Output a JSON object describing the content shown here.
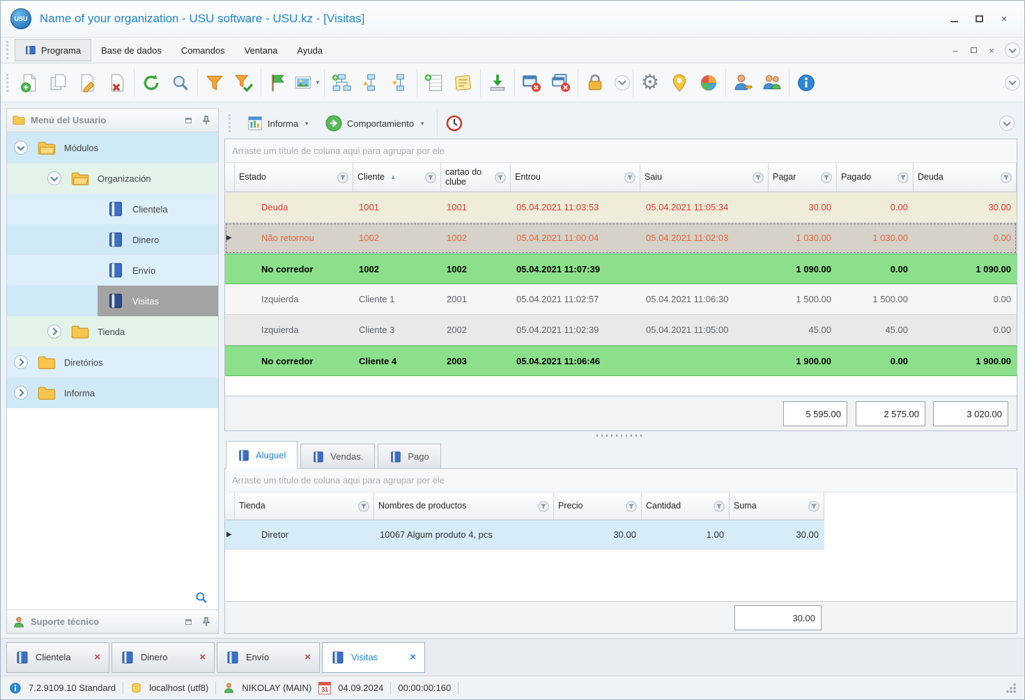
{
  "window": {
    "logo_text": "USU",
    "title": "Name of your organization - USU software - USU.kz - [Visitas]"
  },
  "menubar": {
    "items": [
      "Programa",
      "Base de dados",
      "Comandos",
      "Ventana",
      "Ayuda"
    ]
  },
  "report_toolbar": {
    "informa": "Informa",
    "comportamiento": "Comportamiento"
  },
  "sidebar": {
    "title": "Menú del Usuario",
    "items": [
      {
        "label": "Módulos"
      },
      {
        "label": "Organización"
      },
      {
        "label": "Clientela"
      },
      {
        "label": "Dinero"
      },
      {
        "label": "Envío"
      },
      {
        "label": "Visitas"
      },
      {
        "label": "Tienda"
      },
      {
        "label": "Diretórios"
      },
      {
        "label": "Informa"
      }
    ],
    "support_title": "Suporte técnico"
  },
  "main_grid": {
    "group_hint": "Arraste um título de coluna aqui para agrupar por ele",
    "columns": [
      "Estado",
      "Cliente",
      "cartao do clube",
      "Entrou",
      "Saiu",
      "Pagar",
      "Pagado",
      "Deuda"
    ],
    "rows": [
      {
        "estado": "Deuda",
        "cliente": "1001",
        "cartao": "1001",
        "entrou": "05.04.2021 11:03:53",
        "saiu": "05.04.2021 11:05:34",
        "pagar": "30.00",
        "pagado": "0.00",
        "deuda": "30.00"
      },
      {
        "estado": "Não retornou",
        "cliente": "1002",
        "cartao": "1002",
        "entrou": "05.04.2021 11:00:04",
        "saiu": "05.04.2021 11:02:03",
        "pagar": "1 030.00",
        "pagado": "1 030.00",
        "deuda": "0.00"
      },
      {
        "estado": "No corredor",
        "cliente": "1002",
        "cartao": "1002",
        "entrou": "05.04.2021 11:07:39",
        "saiu": "",
        "pagar": "1 090.00",
        "pagado": "0.00",
        "deuda": "1 090.00"
      },
      {
        "estado": "Izquierda",
        "cliente": "Cliente 1",
        "cartao": "2001",
        "entrou": "05.04.2021 11:02:57",
        "saiu": "05.04.2021 11:06:30",
        "pagar": "1 500.00",
        "pagado": "1 500.00",
        "deuda": "0.00"
      },
      {
        "estado": "Izquierda",
        "cliente": "Cliente 3",
        "cartao": "2002",
        "entrou": "05.04.2021 11:02:39",
        "saiu": "05.04.2021 11:05:00",
        "pagar": "45.00",
        "pagado": "45.00",
        "deuda": "0.00"
      },
      {
        "estado": "No corredor",
        "cliente": "Cliente 4",
        "cartao": "2003",
        "entrou": "05.04.2021 11:06:46",
        "saiu": "",
        "pagar": "1 900.00",
        "pagado": "0.00",
        "deuda": "1 900.00"
      }
    ],
    "totals": [
      "5 595.00",
      "2 575.00",
      "3 020.00"
    ]
  },
  "detail_tabs": [
    {
      "label": "Aluguel"
    },
    {
      "label": "Vendas."
    },
    {
      "label": "Pago"
    }
  ],
  "detail_grid": {
    "group_hint": "Arraste um título de coluna aqui para agrupar por ele",
    "columns": [
      "Tienda",
      "Nombres de productos",
      "Precio",
      "Cantidad",
      "Suma"
    ],
    "rows": [
      {
        "tienda": "Diretor",
        "produto": "10067 Algum produto 4, pcs",
        "precio": "30.00",
        "cantidad": "1.00",
        "suma": "30.00"
      }
    ],
    "total": "30.00"
  },
  "window_tabs": [
    {
      "label": "Clientela"
    },
    {
      "label": "Dinero"
    },
    {
      "label": "Envío"
    },
    {
      "label": "Visitas"
    }
  ],
  "statusbar": {
    "version": "7.2.9109.10 Standard",
    "database": "localhost (utf8)",
    "user": "NIKOLAY (MAIN)",
    "calendar_day": "31",
    "date": "04.09.2024",
    "timer": "00:00:00:160"
  },
  "icons": {
    "close_x": "×",
    "minimize": "–",
    "caret_down": "▼",
    "sort_asc": "▲",
    "row_marker": "▶",
    "gear": "⚙"
  },
  "colors": {
    "accent_blue": "#1f85d6",
    "row_green": "#8ce08b",
    "row_debt_bg": "#efecd9",
    "row_debt_text": "#e03a2f",
    "row_noreturn_bg": "#d6d2c9",
    "row_noreturn_text": "#e0653a",
    "selected_tree_bg": "#a3a3a3"
  }
}
